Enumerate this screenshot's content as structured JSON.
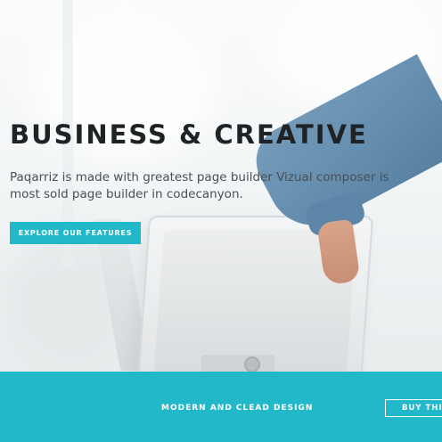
{
  "hero": {
    "headline": "BUSINESS & CREATIVE",
    "subtext": "Paqarriz is made with greatest page builder Vizual composer is most sold page builder in codecanyon.",
    "cta_label": "EXPLORE OUR FEATURES"
  },
  "footer": {
    "tagline": "MODERN AND CLEAD DESIGN",
    "buy_label": "BUY THIS"
  },
  "colors": {
    "accent": "#21b8c9",
    "headline": "#1f2326",
    "body_text": "#4a4f53"
  }
}
